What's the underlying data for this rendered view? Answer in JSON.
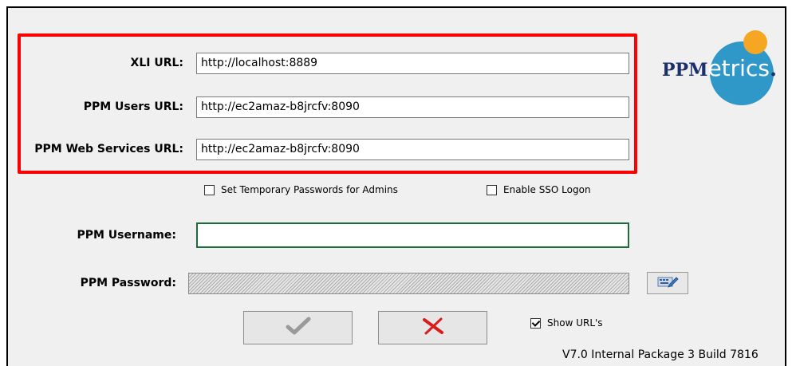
{
  "fields": {
    "xli_label": "XLI URL:",
    "xli_value": "http://localhost:8889",
    "users_label": "PPM Users URL:",
    "users_value": "http://ec2amaz-b8jrcfv:8090",
    "webservices_label": "PPM Web Services URL:",
    "webservices_value": "http://ec2amaz-b8jrcfv:8090",
    "username_label": "PPM Username:",
    "username_value": "",
    "password_label": "PPM Password:"
  },
  "options": {
    "temp_passwords_label": "Set Temporary Passwords for Admins",
    "temp_passwords_checked": false,
    "sso_label": "Enable SSO Logon",
    "sso_checked": false,
    "show_urls_label": "Show URL's",
    "show_urls_checked": true
  },
  "logo": {
    "pp": "PP",
    "m": "M",
    "etrics": "etrics",
    "dot": "."
  },
  "footer": {
    "version": "V7.0 Internal Package 3 Build 7816"
  },
  "colors": {
    "highlight": "#ff0000",
    "logo_blue": "#2f98c9",
    "logo_orange": "#f5a623",
    "ok_check": "#9a9a9a",
    "cancel_x": "#d81c1c"
  },
  "icons": {
    "ok": "checkmark-icon",
    "cancel": "x-icon",
    "password_edit": "edit-password-icon"
  }
}
